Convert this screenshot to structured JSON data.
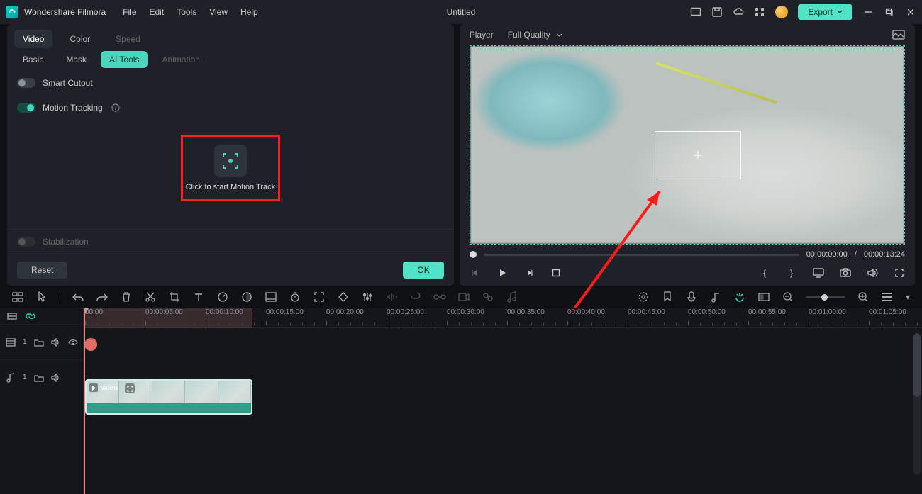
{
  "app": {
    "name": "Wondershare Filmora",
    "doc_title": "Untitled"
  },
  "menu": {
    "file": "File",
    "edit": "Edit",
    "tools": "Tools",
    "view": "View",
    "help": "Help"
  },
  "export": {
    "label": "Export"
  },
  "left_panel": {
    "tabs_primary": {
      "video": "Video",
      "color": "Color",
      "speed": "Speed"
    },
    "tabs_secondary": {
      "basic": "Basic",
      "mask": "Mask",
      "ai_tools": "AI Tools",
      "animation": "Animation"
    },
    "smart_cutout": "Smart Cutout",
    "motion_tracking": "Motion Tracking",
    "motion_button": "Click to start Motion Track",
    "stabilization": "Stabilization",
    "reset": "Reset",
    "ok": "OK"
  },
  "player": {
    "tab": "Player",
    "quality": "Full Quality",
    "time_current": "00:00:00:00",
    "time_sep": "/",
    "time_total": "00:00:13:24"
  },
  "timeline": {
    "ticks": [
      "00:00",
      "00:00:05:00",
      "00:00:10:00",
      "00:00:15:00",
      "00:00:20:00",
      "00:00:25:00",
      "00:00:30:00",
      "00:00:35:00",
      "00:00:40:00",
      "00:00:45:00",
      "00:00:50:00",
      "00:00:55:00",
      "00:01:00:00",
      "00:01:05:00"
    ],
    "video_track_index": "1",
    "audio_track_index": "1",
    "clip_name": "video"
  }
}
